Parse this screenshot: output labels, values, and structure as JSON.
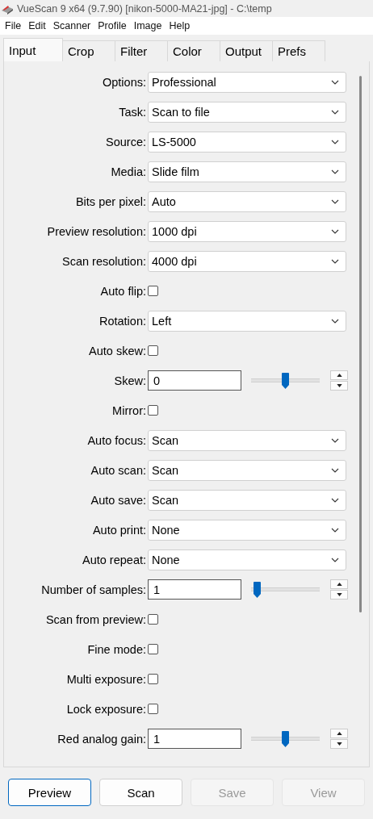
{
  "window": {
    "title": "VueScan 9 x64 (9.7.90) [nikon-5000-MA21-jpg] - C:\\temp"
  },
  "menu": [
    "File",
    "Edit",
    "Scanner",
    "Profile",
    "Image",
    "Help"
  ],
  "tabs": [
    {
      "label": "Input",
      "selected": true
    },
    {
      "label": "Crop",
      "selected": false
    },
    {
      "label": "Filter",
      "selected": false
    },
    {
      "label": "Color",
      "selected": false
    },
    {
      "label": "Output",
      "selected": false
    },
    {
      "label": "Prefs",
      "selected": false
    }
  ],
  "settings": [
    {
      "kind": "select",
      "label": "Options:",
      "value": "Professional"
    },
    {
      "kind": "select",
      "label": "Task:",
      "value": "Scan to file"
    },
    {
      "kind": "select",
      "label": "Source:",
      "value": "LS-5000"
    },
    {
      "kind": "select",
      "label": "Media:",
      "value": "Slide film"
    },
    {
      "kind": "select",
      "label": "Bits per pixel:",
      "value": "Auto"
    },
    {
      "kind": "select",
      "label": "Preview resolution:",
      "value": "1000 dpi"
    },
    {
      "kind": "select",
      "label": "Scan resolution:",
      "value": "4000 dpi"
    },
    {
      "kind": "checkbox",
      "label": "Auto flip:",
      "checked": false
    },
    {
      "kind": "select",
      "label": "Rotation:",
      "value": "Left"
    },
    {
      "kind": "checkbox",
      "label": "Auto skew:",
      "checked": false
    },
    {
      "kind": "slider",
      "label": "Skew:",
      "value": "0",
      "level": 0.5
    },
    {
      "kind": "checkbox",
      "label": "Mirror:",
      "checked": false
    },
    {
      "kind": "select",
      "label": "Auto focus:",
      "value": "Scan"
    },
    {
      "kind": "select",
      "label": "Auto scan:",
      "value": "Scan"
    },
    {
      "kind": "select",
      "label": "Auto save:",
      "value": "Scan"
    },
    {
      "kind": "select",
      "label": "Auto print:",
      "value": "None"
    },
    {
      "kind": "select",
      "label": "Auto repeat:",
      "value": "None"
    },
    {
      "kind": "slider",
      "label": "Number of samples:",
      "value": "1",
      "level": 0.04
    },
    {
      "kind": "checkbox",
      "label": "Scan from preview:",
      "checked": false
    },
    {
      "kind": "checkbox",
      "label": "Fine mode:",
      "checked": false
    },
    {
      "kind": "checkbox",
      "label": "Multi exposure:",
      "checked": false
    },
    {
      "kind": "checkbox",
      "label": "Lock exposure:",
      "checked": false
    },
    {
      "kind": "slider",
      "label": "Red analog gain:",
      "value": "1",
      "level": 0.5
    }
  ],
  "buttons": [
    {
      "label": "Preview",
      "disabled": false,
      "selected": true
    },
    {
      "label": "Scan",
      "disabled": false,
      "selected": false
    },
    {
      "label": "Save",
      "disabled": true,
      "selected": false
    },
    {
      "label": "View",
      "disabled": true,
      "selected": false
    }
  ]
}
